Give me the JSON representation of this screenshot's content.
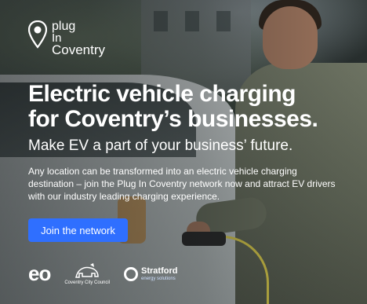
{
  "brand": {
    "logo_line1": "plug",
    "logo_line2": "In",
    "logo_line3": "Coventry"
  },
  "headline_line1": "Electric vehicle charging",
  "headline_line2": "for Coventry’s businesses.",
  "subheadline": "Make EV a part of your business’ future.",
  "body_text": "Any location can be transformed into an electric vehicle charging destination – join the Plug In Coventry network now and attract EV drivers with our industry leading charging experience.",
  "cta_label": "Join the network",
  "partners": {
    "eo": "eo",
    "council": "Coventry City Council",
    "stratford_name": "Stratford",
    "stratford_sub": "energy solutions"
  },
  "colors": {
    "cta": "#2f6fff",
    "text": "#ffffff"
  }
}
